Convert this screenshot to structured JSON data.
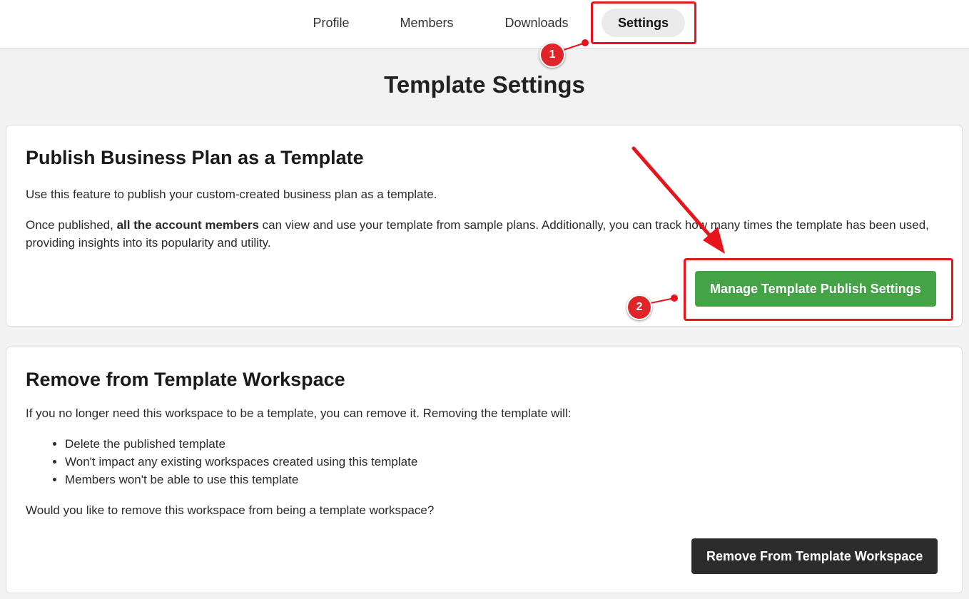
{
  "nav": {
    "tabs": [
      {
        "label": "Profile"
      },
      {
        "label": "Members"
      },
      {
        "label": "Downloads"
      },
      {
        "label": "Settings",
        "active": true
      }
    ]
  },
  "page": {
    "title": "Template Settings"
  },
  "publish_card": {
    "heading": "Publish Business Plan as a Template",
    "intro": "Use this feature to publish your custom-created business plan as a template.",
    "detail_prefix": "Once published, ",
    "detail_bold": "all the account members",
    "detail_suffix": " can view and use your template from sample plans. Additionally, you can track how many times the template has been used, providing insights into its popularity and utility.",
    "button_label": "Manage Template Publish Settings"
  },
  "remove_card": {
    "heading": "Remove from Template Workspace",
    "intro": "If you no longer need this workspace to be a template, you can remove it. Removing the template will:",
    "items": [
      "Delete the published template",
      "Won't impact any existing workspaces created using this template",
      "Members won't be able to use this template"
    ],
    "question": "Would you like to remove this workspace from being a template workspace?",
    "button_label": "Remove From Template Workspace"
  },
  "annotations": {
    "step1": "1",
    "step2": "2",
    "color": "#e8141c"
  },
  "colors": {
    "accent_green": "#44a346",
    "dark_button": "#2c2c2c",
    "background": "#f1f2f1"
  }
}
